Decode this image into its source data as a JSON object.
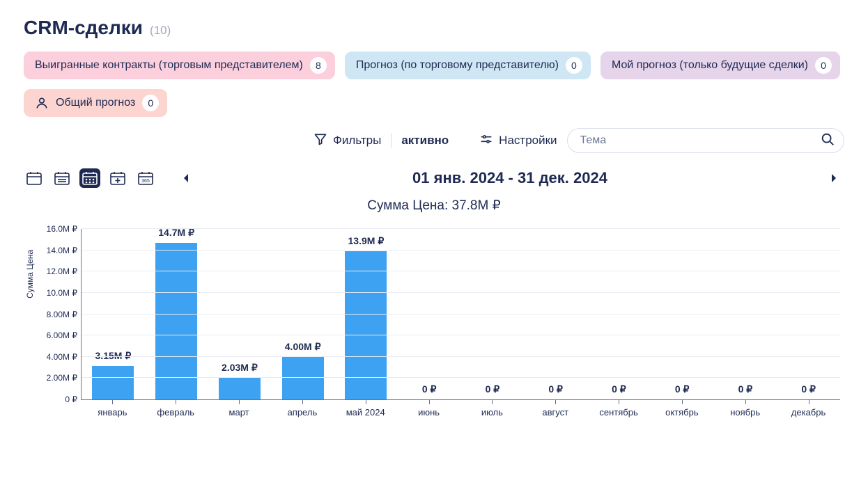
{
  "title": "CRM-сделки",
  "count_label": "(10)",
  "tabs": [
    {
      "label": "Выигранные контракты (торговым представителем)",
      "badge": "8",
      "color": "pink"
    },
    {
      "label": "Прогноз (по торговому представителю)",
      "badge": "0",
      "color": "blue"
    },
    {
      "label": "Мой прогноз (только будущие сделки)",
      "badge": "0",
      "color": "lilac"
    },
    {
      "label": "Общий прогноз",
      "badge": "0",
      "color": "red",
      "has_person_icon": true
    }
  ],
  "toolbar": {
    "filters_label": "Фильтры",
    "active_label": "активно",
    "settings_label": "Настройки",
    "search_placeholder": "Тема"
  },
  "date_range": "01 янв. 2024 - 31 дек. 2024",
  "summary": "Сумма Цена: 37.8M ₽",
  "y_axis_label": "Сумма Цена",
  "chart_data": {
    "type": "bar",
    "title": "Сумма Цена: 37.8M ₽",
    "xlabel": "",
    "ylabel": "Сумма Цена",
    "currency": "₽",
    "ylim": [
      0,
      16000000
    ],
    "y_ticks": [
      "0 ₽",
      "2.00M ₽",
      "4.00M ₽",
      "6.00M ₽",
      "8.00M ₽",
      "10.0M ₽",
      "12.0M ₽",
      "14.0M ₽",
      "16.0M ₽"
    ],
    "categories": [
      "январь",
      "февраль",
      "март",
      "апрель",
      "май 2024",
      "июнь",
      "июль",
      "август",
      "сентябрь",
      "октябрь",
      "ноябрь",
      "декабрь"
    ],
    "values": [
      3150000,
      14700000,
      2030000,
      4000000,
      13900000,
      0,
      0,
      0,
      0,
      0,
      0,
      0
    ],
    "value_labels": [
      "3.15M ₽",
      "14.7M ₽",
      "2.03M ₽",
      "4.00M ₽",
      "13.9M ₽",
      "0 ₽",
      "0 ₽",
      "0 ₽",
      "0 ₽",
      "0 ₽",
      "0 ₽",
      "0 ₽"
    ]
  }
}
